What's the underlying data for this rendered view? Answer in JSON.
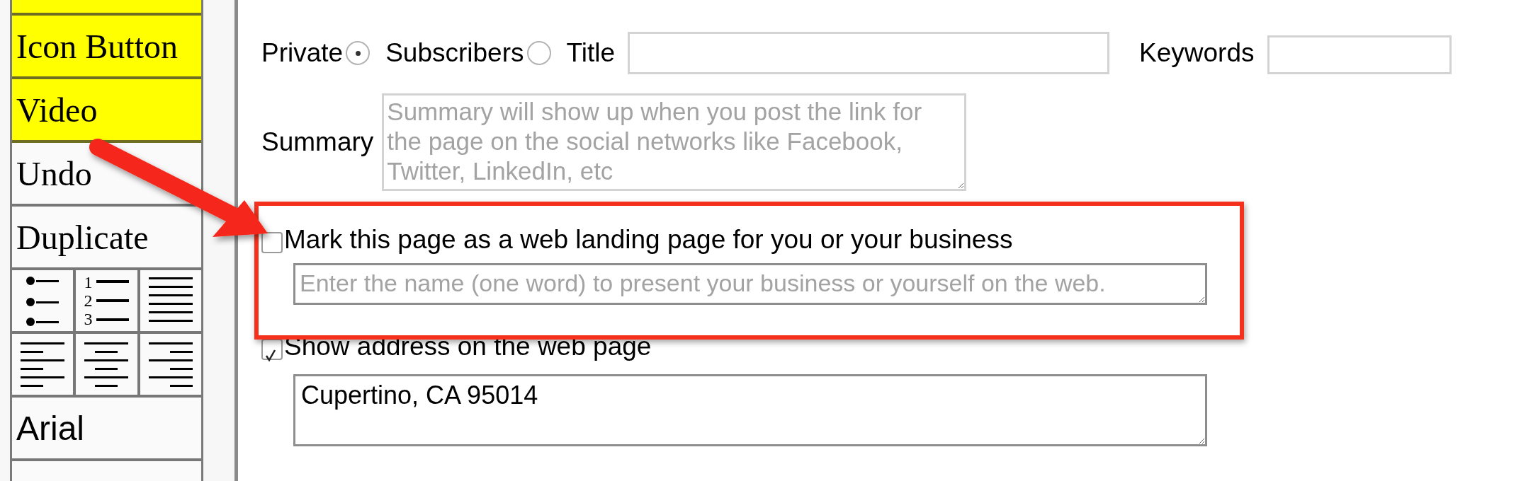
{
  "sidebar": {
    "items": [
      {
        "kind": "empty",
        "highlighted": true
      },
      {
        "kind": "text",
        "label": "Icon Button",
        "highlighted": true
      },
      {
        "kind": "text",
        "label": "Video",
        "highlighted": true
      },
      {
        "kind": "text",
        "label": "Undo",
        "highlighted": false
      },
      {
        "kind": "text",
        "label": "Duplicate",
        "highlighted": false
      },
      {
        "kind": "list-buttons",
        "numbers": [
          "1",
          "2",
          "3"
        ],
        "highlighted": false
      },
      {
        "kind": "align-buttons",
        "highlighted": false
      },
      {
        "kind": "font",
        "label": "Arial",
        "highlighted": false
      },
      {
        "kind": "empty",
        "highlighted": false
      }
    ]
  },
  "visibility": [
    {
      "label": "Private",
      "selected": true
    },
    {
      "label": "Subscribers",
      "selected": false
    }
  ],
  "title_field": {
    "label": "Title"
  },
  "keywords_field": {
    "label": "Keywords"
  },
  "summary": {
    "label": "Summary",
    "placeholder": "Summary will show up when you post the link for the page on the social networks like Facebook, Twitter, LinkedIn, etc"
  },
  "landing_page": {
    "label": "Mark this page as a web landing page for you or your business",
    "checked": false,
    "placeholder": "Enter the name (one word) to present your business or yourself on the web."
  },
  "address": {
    "label": "Show address on the web page",
    "checked": true,
    "value": "Cupertino, CA 95014"
  }
}
